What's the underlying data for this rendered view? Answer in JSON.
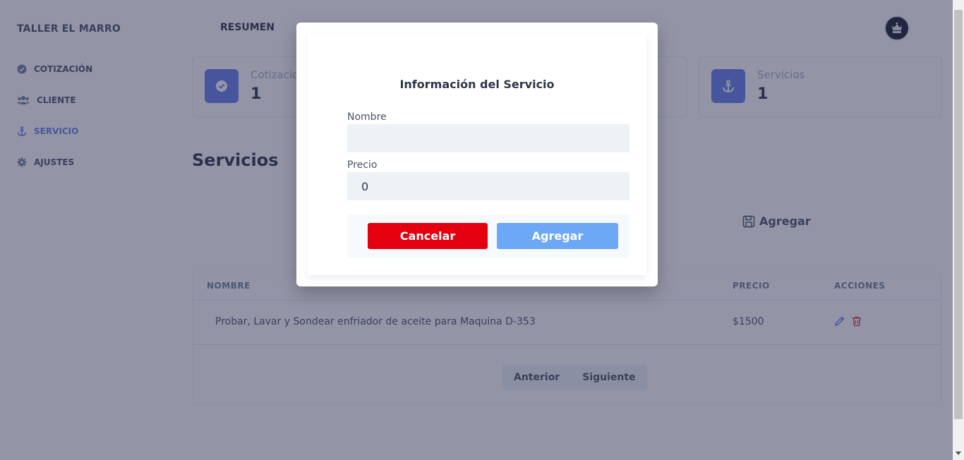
{
  "sidebar": {
    "brand": "TALLER EL MARRO",
    "items": [
      {
        "label": "COTIZACIÓN",
        "icon": "check-circle-icon"
      },
      {
        "label": "CLIENTE",
        "icon": "users-icon"
      },
      {
        "label": "SERVICIO",
        "icon": "anchor-icon",
        "active": true
      },
      {
        "label": "AJUSTES",
        "icon": "gear-icon"
      }
    ]
  },
  "header": {
    "title": "RESUMEN",
    "avatar_icon": "crest-icon"
  },
  "cards": [
    {
      "label": "Cotizaciones",
      "value": "1",
      "icon": "check-circle-icon"
    },
    {
      "label": "Servicios",
      "value": "1",
      "icon": "anchor-icon"
    }
  ],
  "main": {
    "section_title": "Servicios",
    "add_label": "Agregar"
  },
  "table": {
    "columns": [
      "NOMBRE",
      "PRECIO",
      "ACCIONES"
    ],
    "rows": [
      {
        "nombre": "Probar, Lavar y Sondear enfriador de aceite para Maquina D-353",
        "precio": "$1500"
      }
    ],
    "pager": {
      "prev": "Anterior",
      "next": "Siguiente"
    }
  },
  "modal": {
    "title": "Información del Servicio",
    "nombre_label": "Nombre",
    "nombre_value": "",
    "precio_label": "Precio",
    "precio_value": "0",
    "cancel_label": "Cancelar",
    "submit_label": "Agregar"
  },
  "colors": {
    "accent": "#667eea",
    "cancel": "#e3000f",
    "submit": "#6ca8f5"
  }
}
